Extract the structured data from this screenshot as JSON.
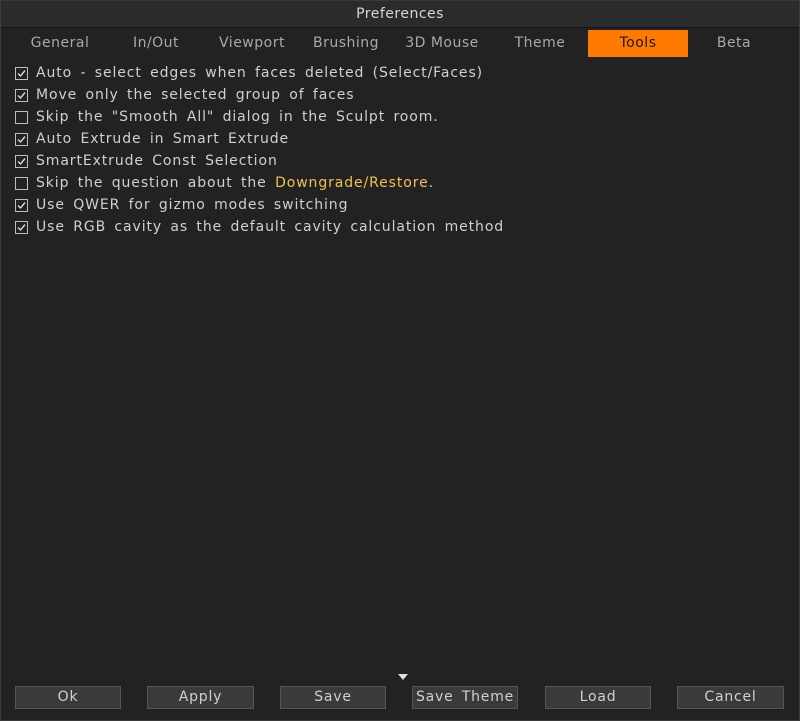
{
  "window": {
    "title": "Preferences"
  },
  "tabs": [
    {
      "label": "General",
      "active": false
    },
    {
      "label": "In/Out",
      "active": false
    },
    {
      "label": "Viewport",
      "active": false
    },
    {
      "label": "Brushing",
      "active": false
    },
    {
      "label": "3D Mouse",
      "active": false
    },
    {
      "label": "Theme",
      "active": false
    },
    {
      "label": "Tools",
      "active": true
    },
    {
      "label": "Beta",
      "active": false
    }
  ],
  "options": [
    {
      "label": "Auto - select edges when faces deleted (Select/Faces)",
      "checked": true
    },
    {
      "label": "Move only the selected group of faces",
      "checked": true
    },
    {
      "label": "Skip the \"Smooth All\" dialog in the Sculpt room.",
      "checked": false
    },
    {
      "label": "Auto Extrude in Smart Extrude",
      "checked": true
    },
    {
      "label": "SmartExtrude Const Selection",
      "checked": true
    },
    {
      "label_prefix": "Skip the question about the ",
      "label_link": "Downgrade/Restore",
      "label_suffix": ".",
      "checked": false
    },
    {
      "label": "Use QWER for gizmo modes switching",
      "checked": true
    },
    {
      "label": "Use RGB cavity as the default cavity calculation method",
      "checked": true
    }
  ],
  "buttons": {
    "ok": "Ok",
    "apply": "Apply",
    "save": "Save",
    "save_theme": "Save Theme",
    "load": "Load",
    "cancel": "Cancel"
  },
  "colors": {
    "accent": "#ff7a00",
    "highlight_text": "#f2c14e",
    "background": "#222222"
  }
}
